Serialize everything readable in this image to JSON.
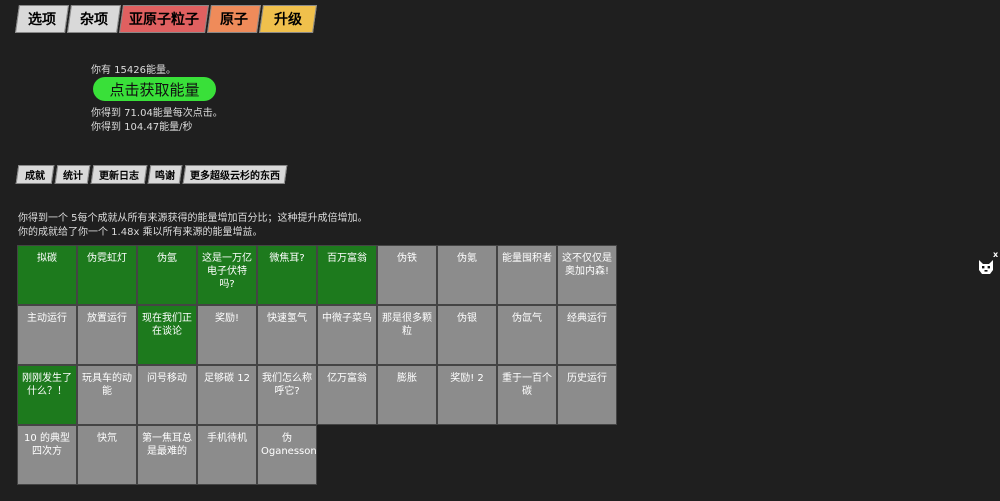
{
  "tabs": [
    {
      "label": "选项"
    },
    {
      "label": "杂项"
    },
    {
      "label": "亚原子粒子"
    },
    {
      "label": "原子"
    },
    {
      "label": "升级"
    }
  ],
  "energy": {
    "have": "你有 15426能量。",
    "button": "点击获取能量",
    "per_click": "你得到 71.04能量每次点击。",
    "per_sec": "你得到 104.47能量/秒"
  },
  "subtabs": [
    {
      "label": "成就"
    },
    {
      "label": "统计"
    },
    {
      "label": "更新日志"
    },
    {
      "label": "鸣谢"
    },
    {
      "label": "更多超级云杉的东西"
    }
  ],
  "achievements_desc": {
    "line1": "你得到一个 5每个成就从所有来源获得的能量增加百分比；这种提升成倍增加。",
    "line2": "你的成就给了你一个 1.48x 乘以所有来源的能量增益。"
  },
  "achievements": [
    [
      {
        "label": "拟碳",
        "done": true
      },
      {
        "label": "伪霓虹灯",
        "done": true
      },
      {
        "label": "伪氩",
        "done": true
      },
      {
        "label": "这是一万亿电子伏特吗?",
        "done": true
      },
      {
        "label": "微焦耳?",
        "done": true
      },
      {
        "label": "百万富翁",
        "done": true
      },
      {
        "label": "伪铁",
        "done": false
      },
      {
        "label": "伪氪",
        "done": false
      },
      {
        "label": "能量囤积者",
        "done": false
      },
      {
        "label": "这不仅仅是奥加内森!",
        "done": false
      }
    ],
    [
      {
        "label": "主动运行",
        "done": false
      },
      {
        "label": "放置运行",
        "done": false
      },
      {
        "label": "现在我们正在谈论",
        "done": true
      },
      {
        "label": "奖励!",
        "done": false
      },
      {
        "label": "快速氢气",
        "done": false
      },
      {
        "label": "中微子菜鸟",
        "done": false
      },
      {
        "label": "那是很多颗粒",
        "done": false
      },
      {
        "label": "伪银",
        "done": false
      },
      {
        "label": "伪氙气",
        "done": false
      },
      {
        "label": "经典运行",
        "done": false
      }
    ],
    [
      {
        "label": "刚刚发生了什么？！",
        "done": true
      },
      {
        "label": "玩具车的动能",
        "done": false
      },
      {
        "label": "问号移动",
        "done": false
      },
      {
        "label": "足够碳 12",
        "done": false
      },
      {
        "label": "我们怎么称呼它?",
        "done": false
      },
      {
        "label": "亿万富翁",
        "done": false
      },
      {
        "label": "膨胀",
        "done": false
      },
      {
        "label": "奖励! 2",
        "done": false
      },
      {
        "label": "重于一百个碳",
        "done": false
      },
      {
        "label": "历史运行",
        "done": false
      }
    ],
    [
      {
        "label": "10 的典型四次方",
        "done": false
      },
      {
        "label": "快氘",
        "done": false
      },
      {
        "label": "第一焦耳总是最难的",
        "done": false
      },
      {
        "label": "手机待机",
        "done": false
      },
      {
        "label": "伪 Oganesson",
        "done": false
      }
    ]
  ],
  "colors": {
    "background": "#1f1f1f",
    "achieved": "#1d7a1d",
    "locked": "#8c8c8c",
    "button": "#39e039",
    "tab_subatomic": "#e06060",
    "tab_atom": "#ef8b5a",
    "tab_upgrade": "#f0c04c"
  },
  "corner": {
    "close": "x",
    "icon": "cat-icon"
  }
}
